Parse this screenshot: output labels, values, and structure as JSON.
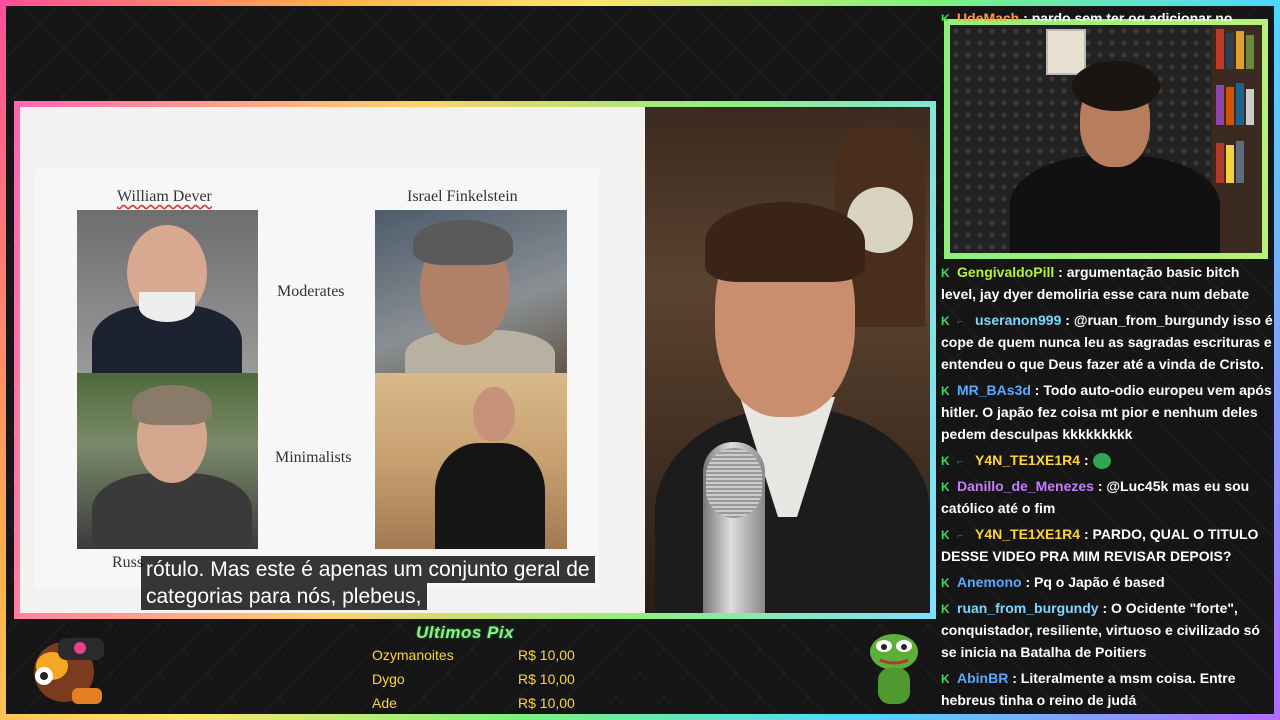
{
  "slide": {
    "name_dever": "William Dever",
    "name_finkelstein": "Israel Finkelstein",
    "category_moderates": "Moderates",
    "category_minimalists": "Minimalists",
    "name_bottom_left_partial": "Russ",
    "name_bottom_right_partial": ""
  },
  "subtitle": {
    "line1": "rótulo. Mas este é apenas um conjunto geral de",
    "line2": "categorias para nós, plebeus,"
  },
  "chat": {
    "messages": [
      {
        "user": "UdeMach",
        "color": "#ff9a3d",
        "text": "pardo sem ter oq adicionar no"
      },
      {
        "user": "GengivaldoPill",
        "color": "#b6f23a",
        "text": "argumentação basic bitch level, jay dyer demoliria esse cara num debate"
      },
      {
        "user": "useranon999",
        "color": "#7fd6ff",
        "text": "@ruan_from_burgundy isso é cope de quem nunca leu as sagradas escrituras e entendeu o que Deus fazer até a vinda de Cristo."
      },
      {
        "user": "MR_BAs3d",
        "color": "#5aa9ff",
        "text": "Todo auto-odio europeu vem após hitler. O japão fez coisa mt pior e nenhum deles pedem desculpas kkkkkkkkk"
      },
      {
        "user": "Y4N_TE1XE1R4",
        "color": "#ffd43b",
        "text": ""
      },
      {
        "user": "Danillo_de_Menezes",
        "color": "#c77dff",
        "text": "@Luc45k mas eu sou católico até o fim"
      },
      {
        "user": "Y4N_TE1XE1R4",
        "color": "#ffd43b",
        "text": "PARDO, QUAL O TITULO DESSE VIDEO PRA MIM REVISAR DEPOIS?"
      },
      {
        "user": "Anemono",
        "color": "#5aa9ff",
        "text": "Pq o Japão é based"
      },
      {
        "user": "ruan_from_burgundy",
        "color": "#7fd6ff",
        "text": "O Ocidente \"forte\", conquistador, resiliente, virtuoso e civilizado só se inicia na Batalha de Poitiers"
      },
      {
        "user": "AbinBR",
        "color": "#5aa9ff",
        "text": "Literalmente a msm coisa. Entre hebreus tinha o reino de judá"
      }
    ]
  },
  "pix": {
    "title": "Ultimos Pix",
    "rows": [
      {
        "name": "Ozymanoites",
        "amount": "R$ 10,00"
      },
      {
        "name": "Dygo",
        "amount": "R$ 10,00"
      },
      {
        "name": "Ade",
        "amount": "R$ 10,00"
      }
    ]
  },
  "colors": {
    "frame_gradient": [
      "#ff4d9a",
      "#ffb347",
      "#ffe66d",
      "#7cf27c",
      "#4dd9ff",
      "#b36bff"
    ],
    "pix_title": "#8ef07a",
    "pix_text": "#ffd43b",
    "badge": "#3ddc5c"
  }
}
